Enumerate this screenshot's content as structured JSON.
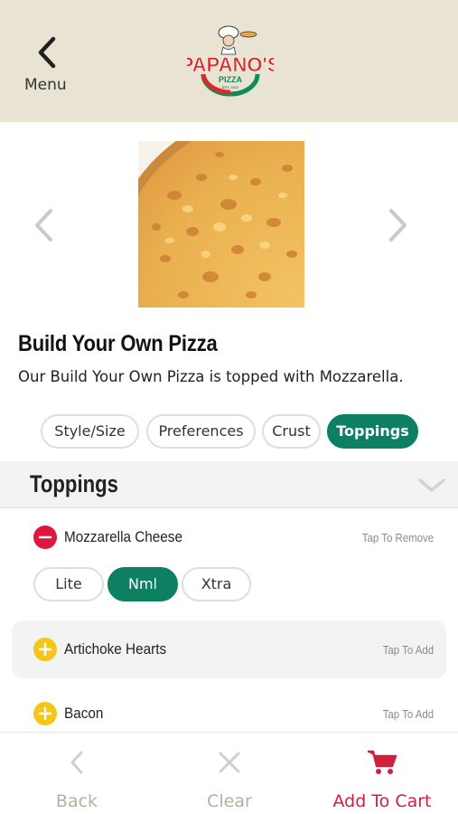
{
  "header": {
    "menu_label": "Menu",
    "logo": {
      "brand": "PAPANO'S",
      "sub": "PIZZA",
      "est": "EST. 1972"
    }
  },
  "product": {
    "title": "Build Your Own Pizza",
    "description": "Our Build Your Own Pizza is topped with Mozzarella."
  },
  "tabs": [
    {
      "label": "Style/Size",
      "active": false
    },
    {
      "label": "Preferences",
      "active": false
    },
    {
      "label": "Crust",
      "active": false
    },
    {
      "label": "Toppings",
      "active": true
    }
  ],
  "section": {
    "title": "Toppings"
  },
  "toppings": [
    {
      "name": "Mozzarella Cheese",
      "action": "Tap To Remove",
      "state": "selected"
    },
    {
      "name": "Artichoke Hearts",
      "action": "Tap To Add",
      "state": "unselected"
    },
    {
      "name": "Bacon",
      "action": "Tap To Add",
      "state": "unselected"
    }
  ],
  "amount_options": [
    {
      "label": "Lite",
      "active": false
    },
    {
      "label": "Nml",
      "active": true
    },
    {
      "label": "Xtra",
      "active": false
    }
  ],
  "bottom_bar": {
    "back_label": "Back",
    "clear_label": "Clear",
    "add_to_cart_label": "Add To Cart"
  },
  "colors": {
    "header_bg": "#e8e3d3",
    "accent_green": "#0d8062",
    "remove_red": "#e0173c",
    "add_yellow": "#f5c518",
    "cart_red": "#d31f3f",
    "muted": "#b3b09f"
  }
}
